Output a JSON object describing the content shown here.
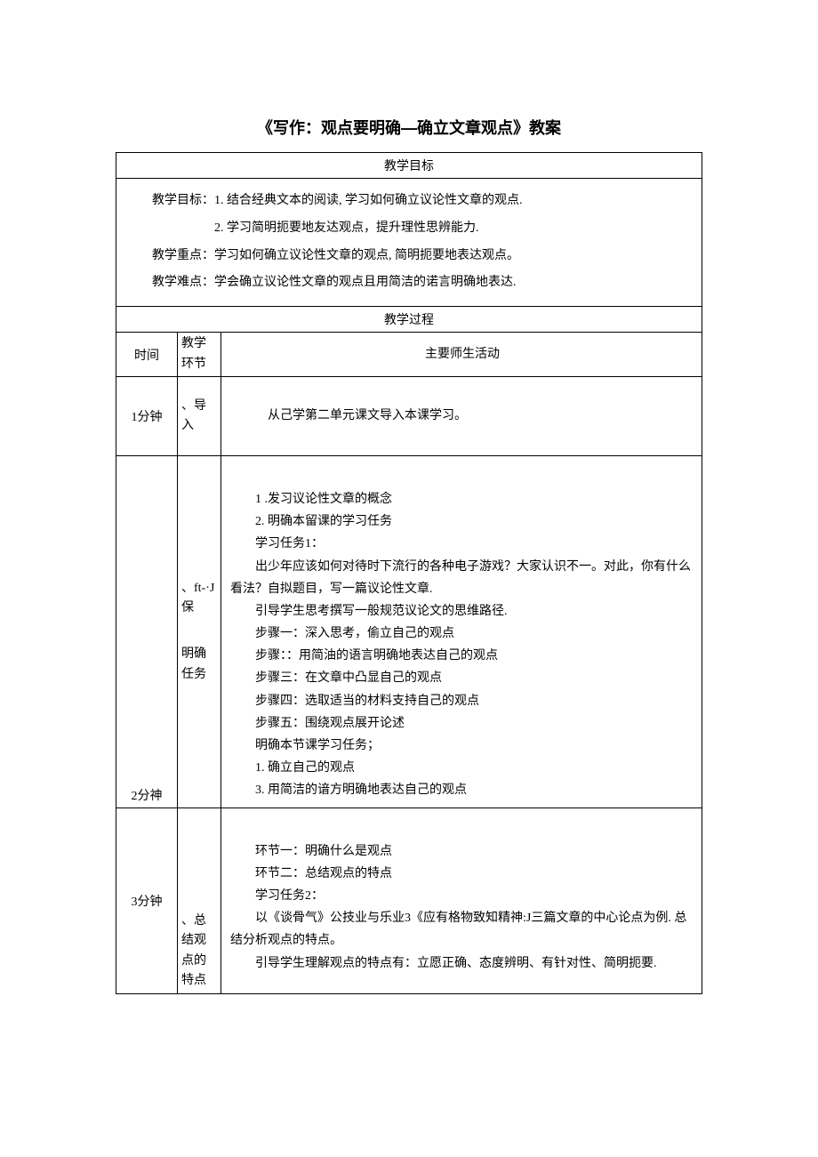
{
  "title": "《写作：观点要明确—确立文章观点》教案",
  "goals_header": "教学目标",
  "goals_line1": "教学目标：1. 结合经典文本的阅读, 学习如何确立议论性文章的观点.",
  "goals_line2": "2. 学习简明扼要地友达观点，提升理性思辨能力.",
  "goals_line3": "教学重点：学习如何确立议论性文章的观点, 简明扼要地表达观点。",
  "goals_line4": "教学难点：学会确立议论性文章的观点且用简洁的诺言明确地表达.",
  "process_header": "教学过程",
  "col_time": "时间",
  "col_step": "教学环节",
  "col_activity": "主要师生活动",
  "row1": {
    "time": "1分钟",
    "step": "、导入",
    "activity": "从己学第二单元课文导入本课学习。"
  },
  "row2": {
    "time": "2分神",
    "step_a": "、ft-·J保",
    "step_b": "明确任务",
    "lines": {
      "l1": "1 .发习议论性文章的概念",
      "l2": "2. 明确本留课的学习任务",
      "l3": "学习任务1：",
      "l4": "出少年应该如何对待时下流行的各种电子游戏？大家认识不一。对此，你有什么看法？自拟题目，写一篇议论性文章.",
      "l5": "引导学生思考撰写一般规范议论文的思维路径.",
      "l6": "步骤一：深入思考，偷立自己的观点",
      "l7": "步骤：：用简油的语言明确地表达自己的观点",
      "l8": "步骤三：在文章中凸显自己的观点",
      "l9": "步骤四：选取适当的材料支持自己的观点",
      "l10": "步骤五：围绕观点展开论述",
      "l11": "明确本节课学习任务；",
      "l12": "1. 确立自己的观点",
      "l13": "3. 用简洁的谙方明确地表达自己的观点"
    }
  },
  "row3": {
    "time": "3分钟",
    "step": "、总结观点的特点",
    "lines": {
      "l1": "环节一：明确什么是观点",
      "l2": "环节二：总结观点的特点",
      "l3": "学习任务2：",
      "l4": "以《谈骨气》公技业与乐业3《应有格物致知精神:J三篇文章的中心论点为例. 总结分析观点的特点。",
      "l5": "引导学生理解观点的特点有：立愿正确、态度辨明、有针对性、简明扼要."
    }
  }
}
